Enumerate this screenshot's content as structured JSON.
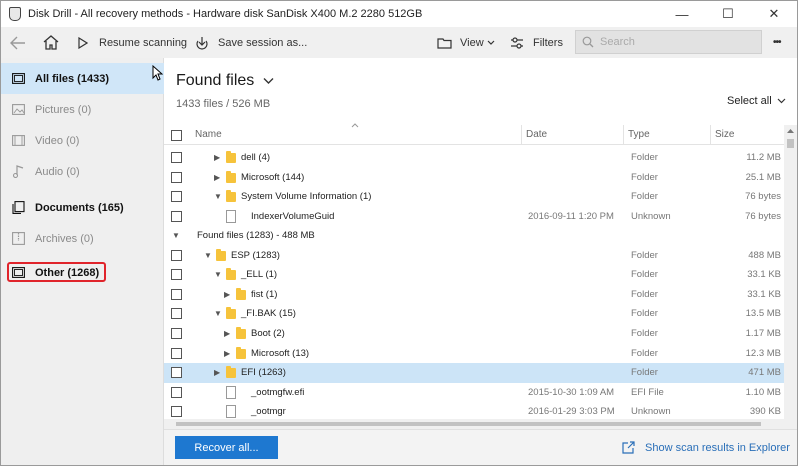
{
  "window": {
    "title": "Disk Drill - All recovery methods - Hardware disk SanDisk X400 M.2 2280 512GB",
    "minimize": "—",
    "maximize": "☐",
    "close": "✕"
  },
  "toolbar": {
    "resume_label": "Resume scanning",
    "save_label": "Save session as...",
    "view_label": "View",
    "filters_label": "Filters",
    "search_placeholder": "Search",
    "more_label": "•••"
  },
  "sidebar": {
    "items": [
      {
        "label": "All files (1433)",
        "icon": "all-files-icon"
      },
      {
        "label": "Pictures (0)",
        "icon": "pictures-icon"
      },
      {
        "label": "Video (0)",
        "icon": "video-icon"
      },
      {
        "label": "Audio (0)",
        "icon": "audio-icon"
      },
      {
        "label": "Documents (165)",
        "icon": "documents-icon"
      },
      {
        "label": "Archives (0)",
        "icon": "archives-icon"
      },
      {
        "label": "Other (1268)",
        "icon": "other-icon"
      }
    ]
  },
  "main": {
    "title": "Found files",
    "subtitle": "1433 files / 526 MB",
    "select_all": "Select all",
    "columns": {
      "name": "Name",
      "date": "Date",
      "type": "Type",
      "size": "Size"
    }
  },
  "rows": [
    {
      "name": "dell (4)",
      "date": "",
      "type": "Folder",
      "size": "11.2 MB",
      "kind": "folder",
      "expanded": false,
      "level": 2
    },
    {
      "name": "Microsoft (144)",
      "date": "",
      "type": "Folder",
      "size": "25.1 MB",
      "kind": "folder",
      "expanded": false,
      "level": 2
    },
    {
      "name": "System Volume Information (1)",
      "date": "",
      "type": "Folder",
      "size": "76 bytes",
      "kind": "folder",
      "expanded": true,
      "level": 2
    },
    {
      "name": "IndexerVolumeGuid",
      "date": "2016-09-11 1:20 PM",
      "type": "Unknown",
      "size": "76 bytes",
      "kind": "file",
      "level": 3
    },
    {
      "group": "Found files (1283) - 488 MB"
    },
    {
      "name": "ESP (1283)",
      "date": "",
      "type": "Folder",
      "size": "488 MB",
      "kind": "folder",
      "expanded": true,
      "level": 1
    },
    {
      "name": "_ELL (1)",
      "date": "",
      "type": "Folder",
      "size": "33.1 KB",
      "kind": "folder",
      "expanded": true,
      "level": 2
    },
    {
      "name": "fist (1)",
      "date": "",
      "type": "Folder",
      "size": "33.1 KB",
      "kind": "folder",
      "expanded": false,
      "level": 3
    },
    {
      "name": "_FI.BAK (15)",
      "date": "",
      "type": "Folder",
      "size": "13.5 MB",
      "kind": "folder",
      "expanded": true,
      "level": 2
    },
    {
      "name": "Boot (2)",
      "date": "",
      "type": "Folder",
      "size": "1.17 MB",
      "kind": "folder",
      "expanded": false,
      "level": 3
    },
    {
      "name": "Microsoft (13)",
      "date": "",
      "type": "Folder",
      "size": "12.3 MB",
      "kind": "folder",
      "expanded": false,
      "level": 3
    },
    {
      "name": "EFI (1263)",
      "date": "",
      "type": "Folder",
      "size": "471 MB",
      "kind": "folder",
      "expanded": false,
      "level": 2,
      "selected": true
    },
    {
      "name": "_ootmgfw.efi",
      "date": "2015-10-30 1:09 AM",
      "type": "EFI File",
      "size": "1.10 MB",
      "kind": "file",
      "level": 3
    },
    {
      "name": "_ootmgr",
      "date": "2016-01-29 3:03 PM",
      "type": "Unknown",
      "size": "390 KB",
      "kind": "file",
      "level": 3
    }
  ],
  "footer": {
    "recover_label": "Recover all...",
    "show_label": "Show scan results in Explorer"
  },
  "colors": {
    "accent": "#1e78d0",
    "highlight": "#e0242b",
    "selection": "#cce4f7"
  }
}
